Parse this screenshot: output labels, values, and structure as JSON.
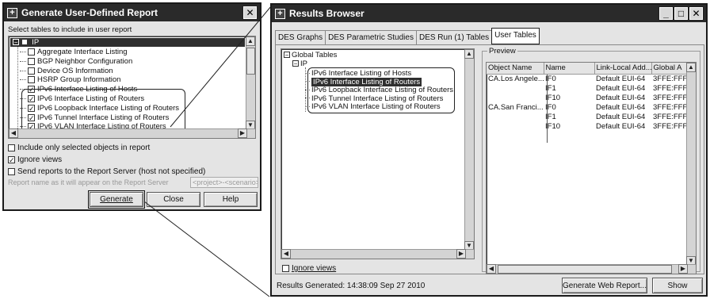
{
  "report_dialog": {
    "title": "Generate User-Defined Report",
    "instruction": "Select tables to include in user report",
    "tree": {
      "root_label": "IP",
      "items": [
        {
          "label": "Aggregate Interface Listing",
          "checked": false
        },
        {
          "label": "BGP Neighbor Configuration",
          "checked": false
        },
        {
          "label": "Device OS Information",
          "checked": false
        },
        {
          "label": "HSRP Group Information",
          "checked": false
        },
        {
          "label": "IPv6 Interface Listing of Hosts",
          "checked": true
        },
        {
          "label": "IPv6 Interface Listing of Routers",
          "checked": true
        },
        {
          "label": "IPv6 Loopback Interface Listing of Routers",
          "checked": true
        },
        {
          "label": "IPv6 Tunnel Interface Listing of Routers",
          "checked": true
        },
        {
          "label": "IPv6 VLAN Interface Listing of Routers",
          "checked": true
        }
      ]
    },
    "options": {
      "include_selected": {
        "label": "Include only selected objects in report",
        "checked": false
      },
      "ignore_views": {
        "label": "Ignore views",
        "checked": true
      },
      "send_reports": {
        "label": "Send reports to the Report Server  (host not specified)",
        "checked": false
      }
    },
    "report_name_label": "Report name as it will appear on the Report Server",
    "report_name_value": "<project>-<scenario>",
    "buttons": {
      "generate": "Generate",
      "close": "Close",
      "help": "Help"
    }
  },
  "results_browser": {
    "title": "Results Browser",
    "tabs": [
      "DES Graphs",
      "DES Parametric Studies",
      "DES Run (1) Tables",
      "User Tables"
    ],
    "active_tab": "User Tables",
    "tree": {
      "root_label": "Global Tables",
      "ip_label": "IP",
      "items": [
        "IPv6 Interface Listing of Hosts",
        "IPv6 Interface Listing of Routers",
        "IPv6 Loopback Interface Listing of Routers",
        "IPv6 Tunnel Interface Listing of Routers",
        "IPv6 VLAN Interface Listing of Routers"
      ],
      "selected_index": 1
    },
    "ignore_views": {
      "label": "Ignore views",
      "checked": false
    },
    "preview": {
      "group_label": "Preview",
      "columns": [
        "Object Name",
        "Name",
        "Link-Local Add...",
        "Global A"
      ],
      "rows": [
        [
          "CA.Los Angele...",
          "IF0",
          "Default EUI-64",
          "3FFE:FFF"
        ],
        [
          "",
          "IF1",
          "Default EUI-64",
          "3FFE:FFF"
        ],
        [
          "",
          "IF10",
          "Default EUI-64",
          "3FFE:FFF"
        ],
        [
          "CA.San Franci...",
          "IF0",
          "Default EUI-64",
          "3FFE:FFF"
        ],
        [
          "",
          "IF1",
          "Default EUI-64",
          "3FFE:FFF"
        ],
        [
          "",
          "IF10",
          "Default EUI-64",
          "3FFE:FFF"
        ]
      ]
    },
    "status": "Results Generated: 14:38:09 Sep 27 2010",
    "buttons": {
      "generate_web_report": "Generate Web Report...",
      "show": "Show"
    }
  },
  "icons": {
    "window_system": "window-system-icon",
    "close": "close-icon",
    "minimize": "minimize-icon",
    "maximize": "maximize-icon"
  },
  "colors": {
    "titlebar": "#2a2a2a",
    "window_bg": "#e4e4e4",
    "selection": "#2f2f2f",
    "callout": "#222222"
  }
}
